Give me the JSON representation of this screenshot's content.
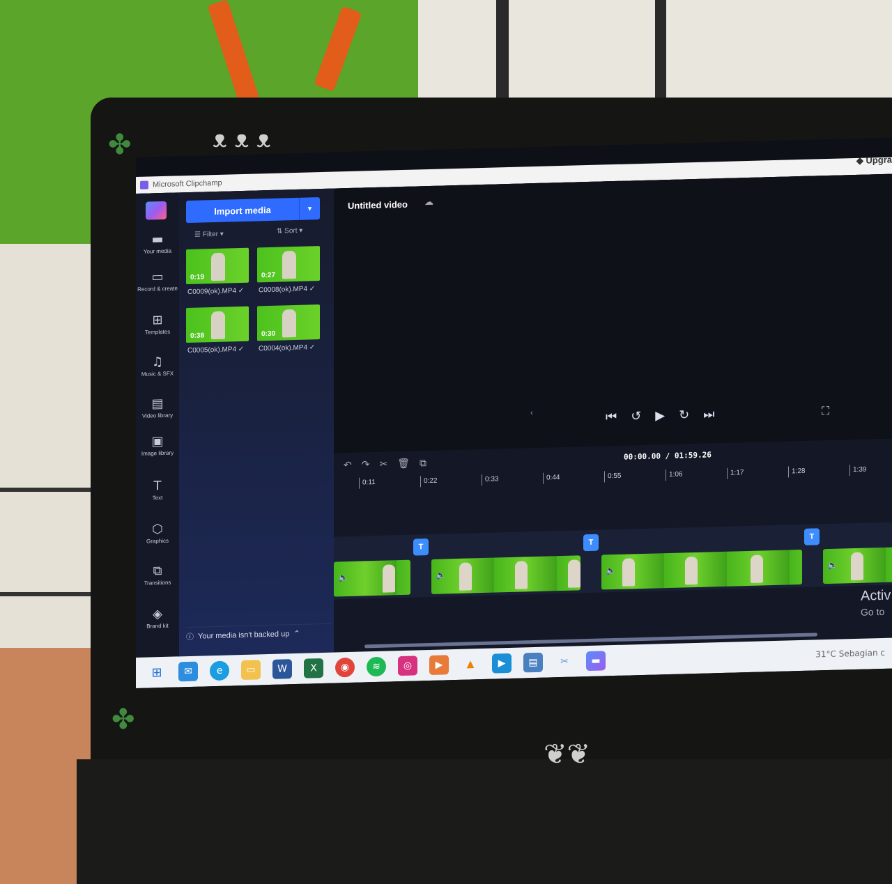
{
  "window": {
    "title": "Microsoft Clipchamp",
    "upgrade_label": "Upgra"
  },
  "rail": [
    {
      "label": "Your media",
      "icon": "folder-icon",
      "glyph": "▬"
    },
    {
      "label": "Record & create",
      "icon": "camera-icon",
      "glyph": "▭"
    },
    {
      "label": "Templates",
      "icon": "templates-icon",
      "glyph": "⊞"
    },
    {
      "label": "Music & SFX",
      "icon": "music-icon",
      "glyph": "♫"
    },
    {
      "label": "Video library",
      "icon": "film-icon",
      "glyph": "▤"
    },
    {
      "label": "Image library",
      "icon": "image-icon",
      "glyph": "▣"
    },
    {
      "label": "Text",
      "icon": "text-icon",
      "glyph": "T"
    },
    {
      "label": "Graphics",
      "icon": "shapes-icon",
      "glyph": "⬡"
    },
    {
      "label": "Transitions",
      "icon": "transitions-icon",
      "glyph": "⧉"
    },
    {
      "label": "Brand kit",
      "icon": "brand-kit-icon",
      "glyph": "◈"
    }
  ],
  "media": {
    "import_label": "Import media",
    "filter_label": "Filter",
    "sort_label": "Sort",
    "items": [
      {
        "duration": "0:19",
        "name": "C0009(ok).MP4 ✓"
      },
      {
        "duration": "0:27",
        "name": "C0008(ok).MP4 ✓"
      },
      {
        "duration": "0:38",
        "name": "C0005(ok).MP4 ✓"
      },
      {
        "duration": "0:30",
        "name": "C0004(ok).MP4 ✓"
      }
    ],
    "backup_text": "Your media isn't backed up"
  },
  "preview": {
    "title": "Untitled video"
  },
  "timeline": {
    "timecode": "00:00.00 / 01:59.26",
    "ticks": [
      "0:11",
      "0:22",
      "0:33",
      "0:44",
      "0:55",
      "1:06",
      "1:17",
      "1:28",
      "1:39"
    ],
    "text_marker": "T"
  },
  "watermark": {
    "line1": "Activ",
    "line2": "Go to"
  },
  "taskbar": {
    "weather": "31°C  Sebagian c"
  },
  "colors": {
    "accent": "#2f6bff",
    "clip_green": "#52bf1f",
    "background": "#12141c"
  }
}
